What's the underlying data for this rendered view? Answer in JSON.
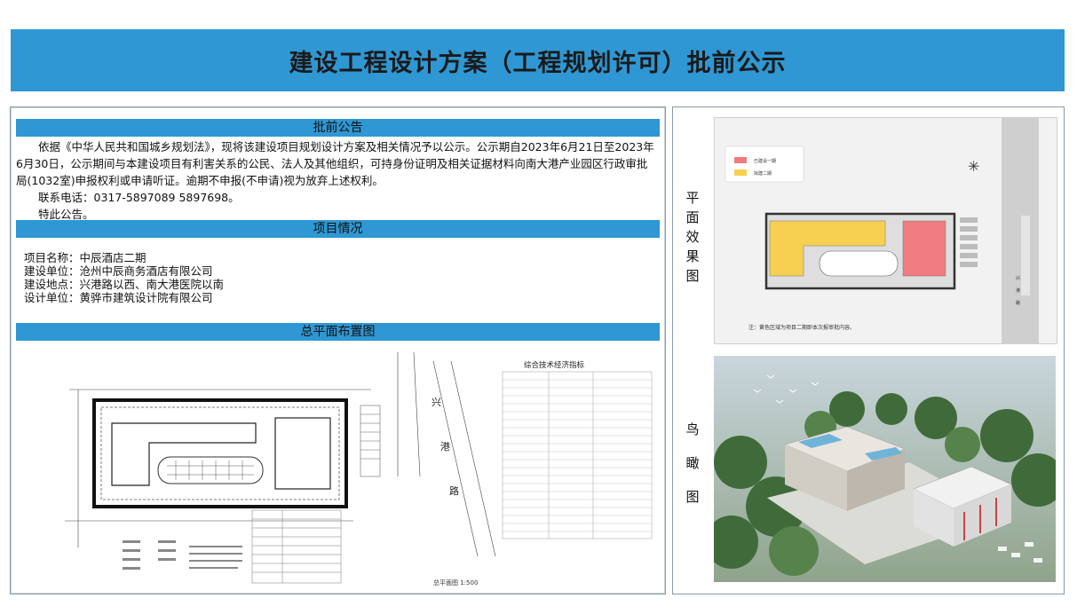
{
  "title": "建设工程设计方案（工程规划许可）批前公示",
  "notice": {
    "heading": "批前公告",
    "paragraph": "依据《中华人民共和国城乡规划法》，现将该建设项目规划设计方案及相关情况予以公示。公示期自2023年6月21日至2023年6月30日，公示期间与本建设项目有利害关系的公民、法人及其他组织，可持身份证明及相关证据材料向南大港产业园区行政审批局(1032室)申报权利或申请听证。逾期不申报(不申请)视为放弃上述权利。",
    "phone": "联系电话：0317-5897089 5897698。",
    "closing": "特此公告。"
  },
  "project": {
    "heading": "项目情况",
    "name": "项目名称：中辰酒店二期",
    "builder": "建设单位：沧州中辰商务酒店有限公司",
    "location": "建设地点：兴港路以西、南大港医院以南",
    "designer": "设计单位：黄骅市建筑设计院有限公司"
  },
  "site_plan": {
    "heading": "总平面布置图",
    "table_title": "综合技术经济指标",
    "road_label": "兴港路",
    "scale_label": "总平面图 1:500"
  },
  "right": {
    "plan_label": "平面效果图",
    "aerial_label": "鸟瞰图",
    "legend": [
      "已建设一期",
      "拟建二期"
    ],
    "note": "注：黄色区域为项目二期即本次报审批内容。",
    "road_vertical": "兴港路",
    "colors": {
      "phase1": "#f07c80",
      "phase2": "#f7d052"
    }
  }
}
